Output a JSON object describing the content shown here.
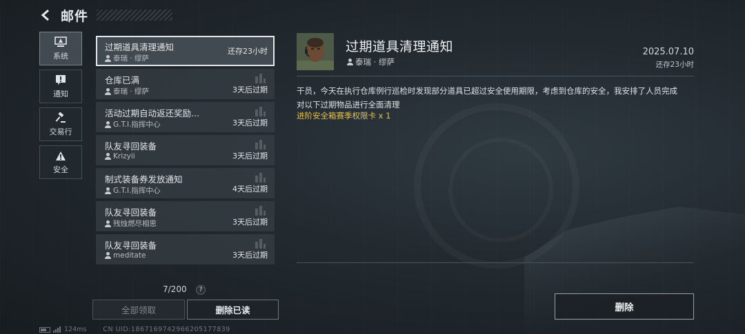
{
  "header": {
    "title": "邮件"
  },
  "tabs": [
    {
      "label": "系统",
      "icon": "system-monitor-icon",
      "active": true
    },
    {
      "label": "通知",
      "icon": "notice-exclaim-icon",
      "active": false
    },
    {
      "label": "交易行",
      "icon": "gavel-icon",
      "active": false
    },
    {
      "label": "安全",
      "icon": "warning-triangle-icon",
      "active": false
    }
  ],
  "mails": [
    {
      "title": "过期道具清理通知",
      "sender": "泰瑞 · 缪萨",
      "expiry": "还存23小时"
    },
    {
      "title": "仓库已满",
      "sender": "泰瑞 · 缪萨",
      "expiry": "3天后过期"
    },
    {
      "title": "活动过期自动返还奖励...",
      "sender": "G.T.I.指挥中心",
      "expiry": "3天后过期"
    },
    {
      "title": "队友寻回装备",
      "sender": "Krizyii",
      "expiry": "3天后过期"
    },
    {
      "title": "制式装备券发放通知",
      "sender": "G.T.I.指挥中心",
      "expiry": "4天后过期"
    },
    {
      "title": "队友寻回装备",
      "sender": "残烛燃尽相思",
      "expiry": "3天后过期"
    },
    {
      "title": "队友寻回装备",
      "sender": "meditate",
      "expiry": "3天后过期"
    }
  ],
  "list_footer": {
    "counter": "7/200",
    "help": "?",
    "claim_all": "全部领取",
    "delete_read": "删除已读"
  },
  "status_bar": {
    "ping": "124ms",
    "uid": "CN UID:1867169742966205177839"
  },
  "detail": {
    "title": "过期道具清理通知",
    "sender": "泰瑞 · 缪萨",
    "date": "2025.07.10",
    "remaining": "还存23小时",
    "body": "干员，今天在执行仓库例行巡检时发现部分道具已超过安全使用期限，考虑到仓库的安全，我安排了人员完成对以下过期物品进行全面清理",
    "reward": "进阶安全箱赛季权限卡 x 1",
    "delete_button": "删除"
  },
  "colors": {
    "reward_gold": "#e6c04f",
    "active_outline": "#e4e8ea",
    "background": "#232b31"
  }
}
